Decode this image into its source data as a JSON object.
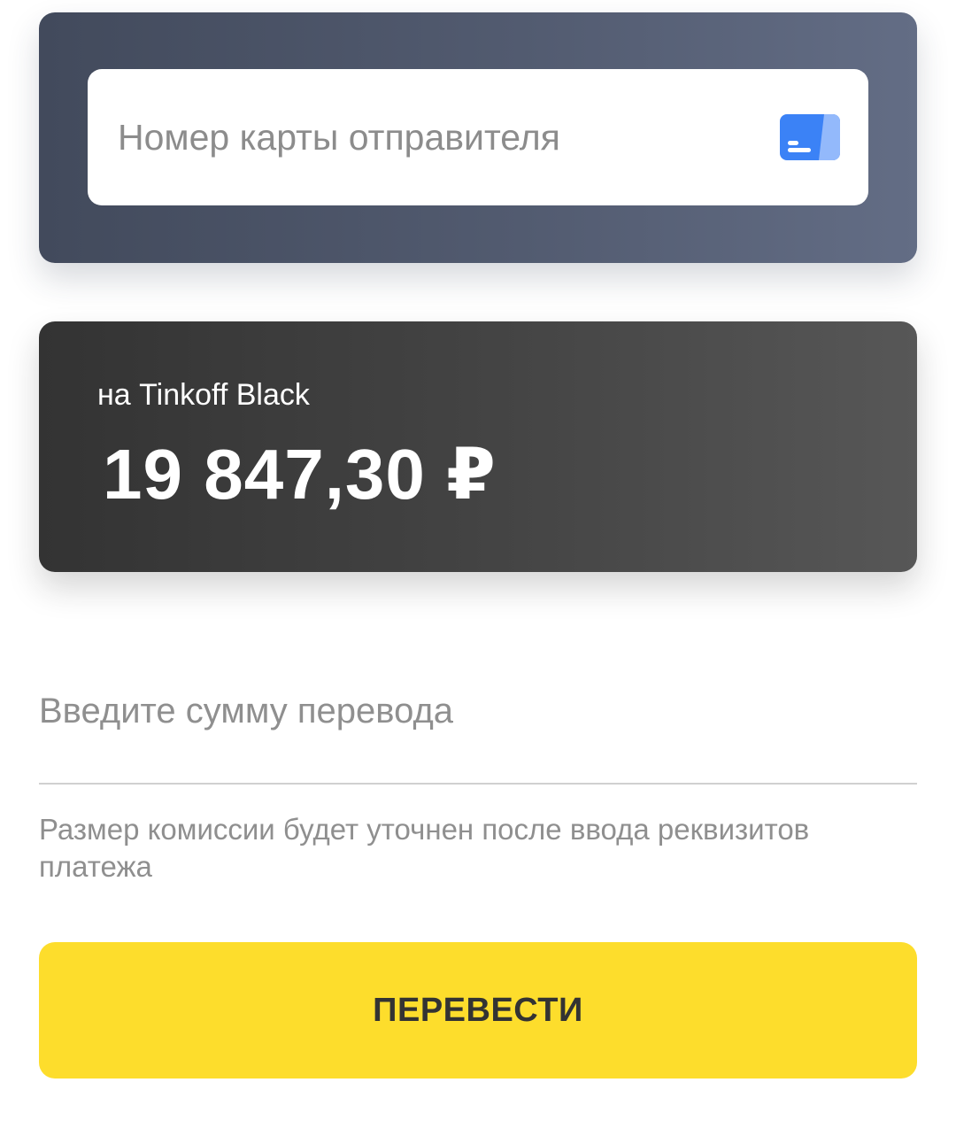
{
  "sender": {
    "card_number_placeholder": "Номер карты отправителя",
    "card_number_value": "",
    "icon": "card-icon",
    "icon_color": "#3b82f6"
  },
  "recipient": {
    "label": "на Tinkoff Black",
    "balance": "19 847,30 ₽"
  },
  "amount": {
    "placeholder": "Введите сумму перевода",
    "value": ""
  },
  "commission_note": "Размер комиссии будет уточнен после ввода реквизитов платежа",
  "actions": {
    "transfer_label": "ПЕРЕВЕСТИ"
  },
  "colors": {
    "button_accent": "#fddd2c",
    "sender_card": "#525b70",
    "recipient_card": "#454545"
  }
}
